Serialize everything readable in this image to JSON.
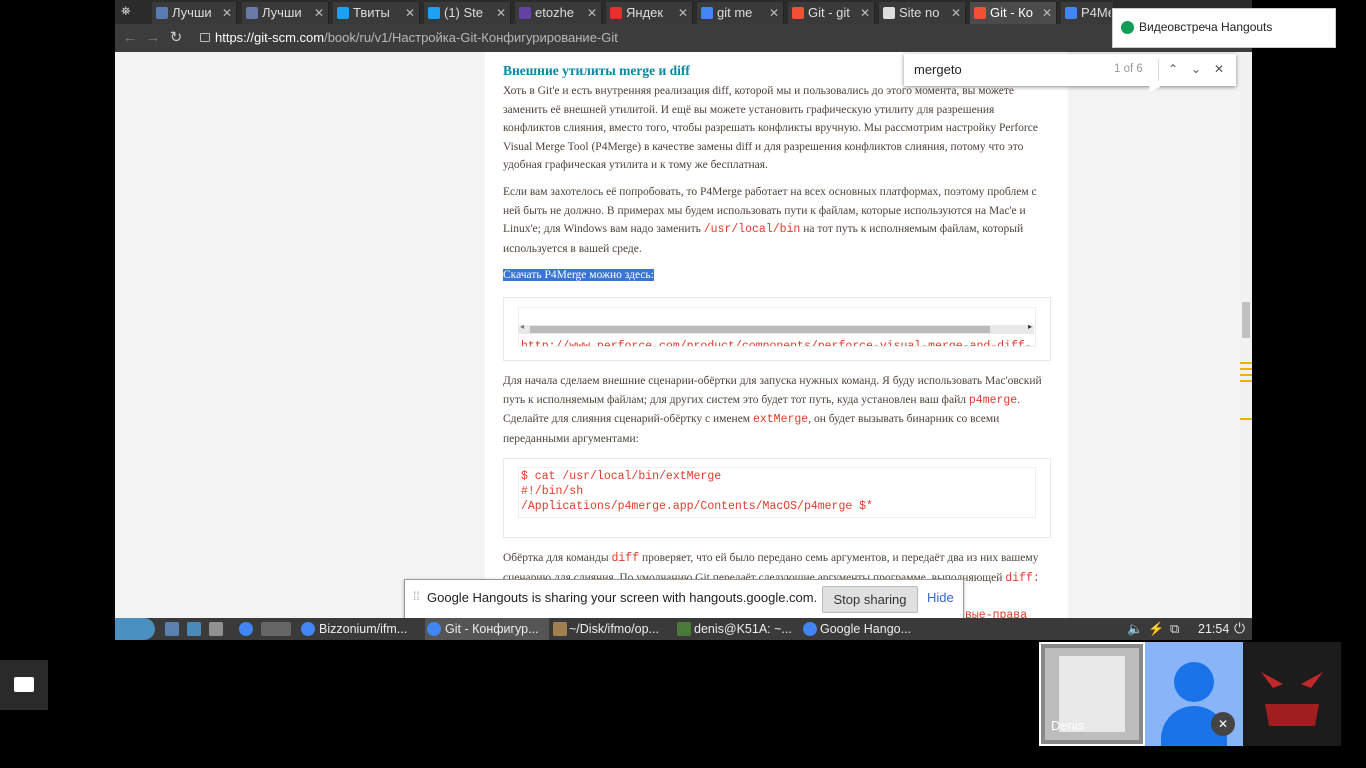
{
  "browser": {
    "tabs": [
      {
        "title": "Лучши",
        "color": "#5b7bb3"
      },
      {
        "title": "Лучши",
        "color": "#6a7aa8"
      },
      {
        "title": "Твиты",
        "color": "#1da1f2"
      },
      {
        "title": "(1) Ste",
        "color": "#1da1f2"
      },
      {
        "title": "etozhe",
        "color": "#6441a5"
      },
      {
        "title": "Яндек",
        "color": "#e62e2e"
      },
      {
        "title": "git me",
        "color": "#4285f4"
      },
      {
        "title": "Git - git",
        "color": "#f05033"
      },
      {
        "title": "Site no",
        "color": "#dddddd"
      },
      {
        "title": "Git - Ко",
        "color": "#f05033"
      },
      {
        "title": "P4Me",
        "color": "#4285f4"
      }
    ],
    "close_glyph": "✕",
    "url_host": "https://git-scm.com",
    "url_path": "/book/ru/v1/Настройка-Git-Конфигурирование-Git"
  },
  "find": {
    "query": "mergeto",
    "count": "1 of 6",
    "prev": "⌃",
    "next": "⌄",
    "close": "✕"
  },
  "hangouts_popup": {
    "title": "Видеовстреча Hangouts"
  },
  "article": {
    "heading": "Внешние утилиты merge и diff",
    "p1": "Хоть в Git'е и есть внутренняя реализация diff, которой мы и пользовались до этого момента, вы можете заменить её внешней утилитой. И ещё вы можете установить графическую утилиту для разрешения конфликтов слияния, вместо того, чтобы разрешать конфликты вручную. Мы рассмотрим настройку Perforce Visual Merge Tool (P4Merge) в качестве замены diff и для разрешения конфликтов слияния, потому что это удобная графическая утилита и к тому же бесплатная.",
    "p2_a": "Если вам захотелось её попробовать, то P4Merge работает на всех основных платформах, поэтому проблем с ней быть не должно. В примерах мы будем использовать пути к файлам, которые используются на Mac'е и Linux'е; для Windows вам надо заменить ",
    "p2_code": "/usr/local/bin",
    "p2_b": " на тот путь к исполняемым файлам, который используется в вашей среде.",
    "p3": "Скачать P4Merge можно здесь:",
    "url_code": "http://www.perforce.com/product/components/perforce-visual-merge-and-diff-",
    "p4_a": "Для начала сделаем внешние сценарии-обёртки для запуска нужных команд. Я буду использовать Mac'овский путь к исполняемым файлам; для других систем это будет тот путь, куда установлен ваш файл ",
    "p4_code1": "p4merge",
    "p4_b": ". Сделайте для слияния сценарий-обёртку с именем ",
    "p4_code2": "extMerge",
    "p4_c": ", он будет вызывать бинарник со всеми переданными аргументами:",
    "code_line1": "$ cat /usr/local/bin/extMerge",
    "code_line2": "#!/bin/sh",
    "code_line3": "/Applications/p4merge.app/Contents/MacOS/p4merge $*",
    "p5_a": "Обёртка для команды ",
    "p5_code": "diff",
    "p5_b": " проверяет, что ей было передано семь аргументов, и передаёт два из них вашему сценарию для слияния. По умолчанию Git передаёт следующие аргументы программе, выполняющей ",
    "p5_code2": "diff:",
    "bottom_code": "вые-права"
  },
  "share_bar": {
    "message": "Google Hangouts is sharing your screen with hangouts.google.com.",
    "stop": "Stop sharing",
    "hide": "Hide"
  },
  "taskbar": {
    "items": [
      {
        "label": "Bizzonium/ifm...",
        "color": "#4285f4"
      },
      {
        "label": "Git - Конфигур...",
        "color": "#4285f4"
      },
      {
        "label": "~/Disk/ifmo/op...",
        "color": "#a08050"
      },
      {
        "label": "denis@K51A: ~...",
        "color": "#4a7a3a"
      },
      {
        "label": "Google Hango...",
        "color": "#4285f4"
      }
    ],
    "clock": "21:54"
  },
  "participants": [
    {
      "name": "Denis"
    }
  ]
}
